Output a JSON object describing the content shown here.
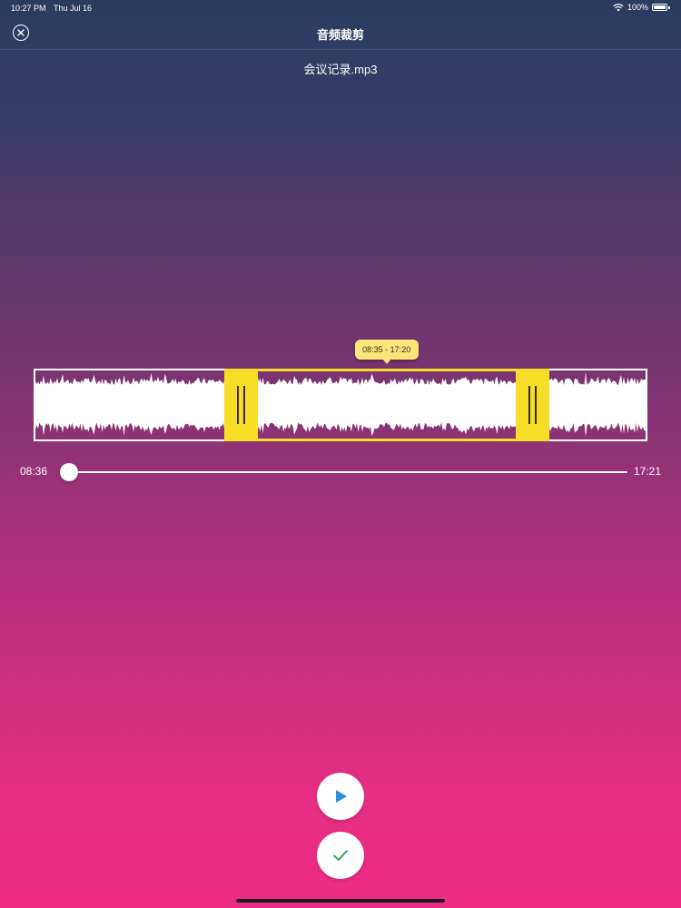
{
  "status_bar": {
    "time": "10:27 PM",
    "date": "Thu Jul 16",
    "battery": "100%",
    "icons": [
      "wifi-icon",
      "battery-icon"
    ]
  },
  "nav": {
    "title": "音频裁剪",
    "close_icon": "close-icon"
  },
  "file": {
    "name": "会议记录.mp3"
  },
  "trim": {
    "range_label": "08:35 - 17:20",
    "selection_start_fraction": 0.365,
    "selection_end_fraction": 0.785
  },
  "playback": {
    "current_time": "08:36",
    "total_time": "17:21",
    "progress_fraction": 0.0
  },
  "buttons": {
    "play_icon": "play-icon",
    "confirm_icon": "checkmark-icon"
  },
  "colors": {
    "accent_yellow": "#f6dd28",
    "tooltip_yellow": "#fce57a",
    "play_blue": "#2f8fd8",
    "confirm_green": "#3aa05a",
    "gradient_top": "#283c60",
    "gradient_bottom": "#ef2c86"
  }
}
